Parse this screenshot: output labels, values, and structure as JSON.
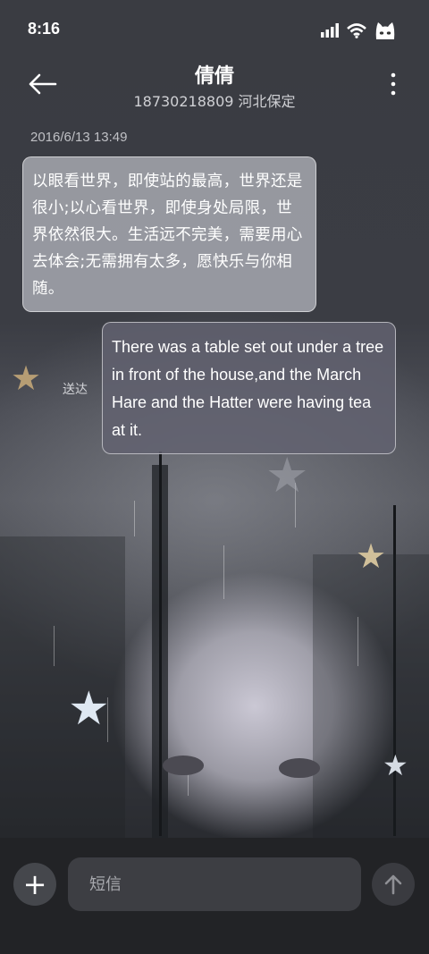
{
  "status_bar": {
    "time": "8:16",
    "icons": [
      "signal-icon",
      "wifi-icon",
      "mascot-icon"
    ]
  },
  "header": {
    "contact_name": "倩倩",
    "contact_detail": "18730218809 河北保定"
  },
  "messages": [
    {
      "direction": "incoming",
      "timestamp": "2016/6/13 13:49",
      "text": "以眼看世界，即使站的最高，世界还是很小;以心看世界，即使身处局限，世界依然很大。生活远不完美，需要用心去体会;无需拥有太多，愿快乐与你相随。"
    },
    {
      "direction": "outgoing",
      "status": "送达",
      "text": "There was a table set out under a tree in front of the house,and the March Hare and the Hatter were having tea at it."
    }
  ],
  "composer": {
    "placeholder": "短信"
  },
  "colors": {
    "bottom_bar": "#222326",
    "input_bg": "#3d3e43",
    "bubble_out": "#626270",
    "bubble_in": "#b0b2ba"
  }
}
